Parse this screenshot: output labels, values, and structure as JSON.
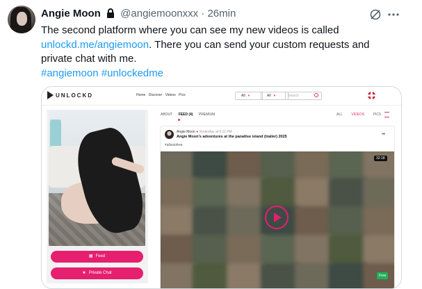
{
  "tweet": {
    "author_name": "Angie Moon",
    "handle": "@angiemoonxxx",
    "separator": "·",
    "time": "26min",
    "text_line1": "The second platform where you can see my new videos is called",
    "link": "unlockd.me/angiemoon",
    "text_line2_rest": ". There you can send your custom requests and",
    "text_line3": "private chat with me.",
    "hashtag1": "#angiemoon",
    "hashtag2": "#unlockedme"
  },
  "embed": {
    "logo": "UNLOCKD",
    "nav": [
      "Home",
      "Discover",
      "Videos",
      "Pics"
    ],
    "select1": "All",
    "select2": "All",
    "search_placeholder": "Search",
    "tabs": [
      "ABOUT",
      "FEED (4)",
      "PREMIUM"
    ],
    "filters": [
      "ALL",
      "VIDEOS",
      "PICS"
    ],
    "post": {
      "name": "Angie Moon",
      "date": "Yesterday at 6:11 PM",
      "title": "Angie Moon's adventures at the paradise island (trailer) 2025",
      "tag": "#allsolofree",
      "duration": "32:18",
      "badge": "Free"
    },
    "buttons": {
      "feed": "Feed",
      "private_chat": "Private Chat"
    }
  },
  "colors": {
    "link": "#1d9bf0",
    "brand_pink": "#e61f6f",
    "muted": "#536471"
  }
}
